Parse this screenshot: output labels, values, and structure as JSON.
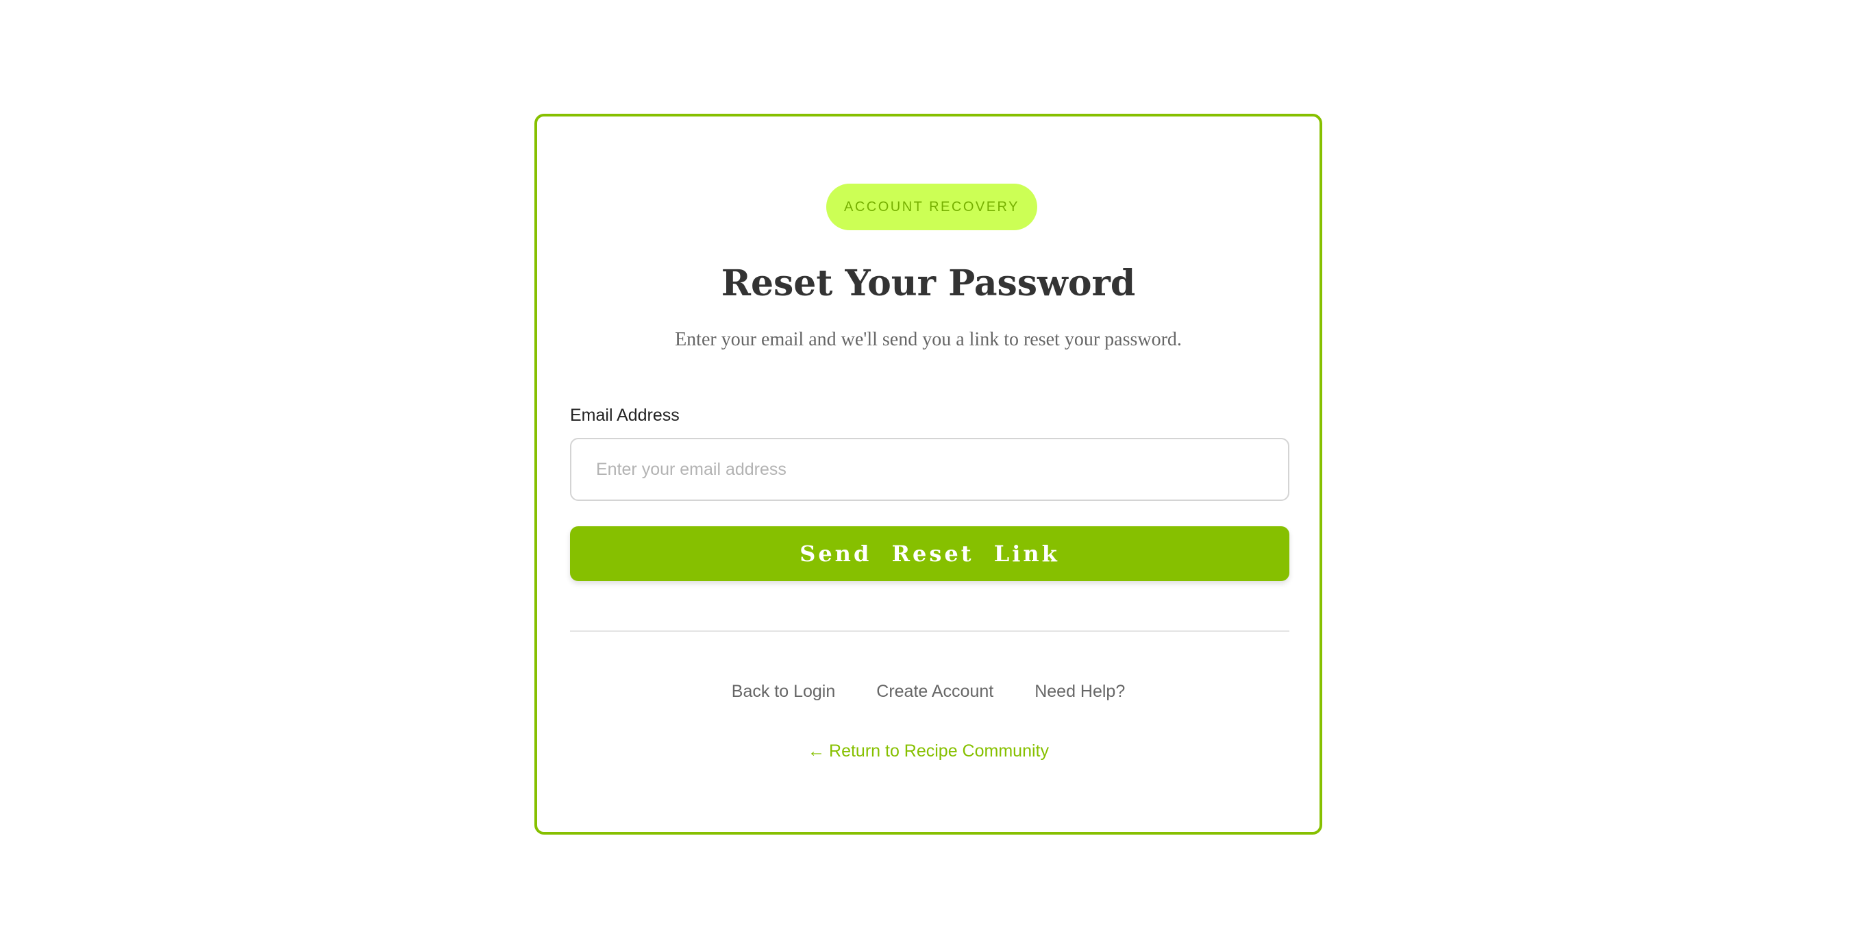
{
  "badge": {
    "label": "ACCOUNT RECOVERY"
  },
  "header": {
    "title": "Reset Your Password",
    "subtitle": "Enter your email and we'll send you a link to reset your password."
  },
  "form": {
    "email_label": "Email Address",
    "email_value": "",
    "email_placeholder": "Enter your email address",
    "submit_label": "Send Reset Link"
  },
  "links": {
    "back_to_login": "Back to Login",
    "create_account": "Create Account",
    "need_help": "Need Help?"
  },
  "return": {
    "icon": "arrow-left-icon",
    "label": "Return to Recipe Community"
  },
  "colors": {
    "accent": "#86c000",
    "badge_bg": "#ccff55",
    "text_dark": "#333333",
    "text_muted": "#666666"
  }
}
